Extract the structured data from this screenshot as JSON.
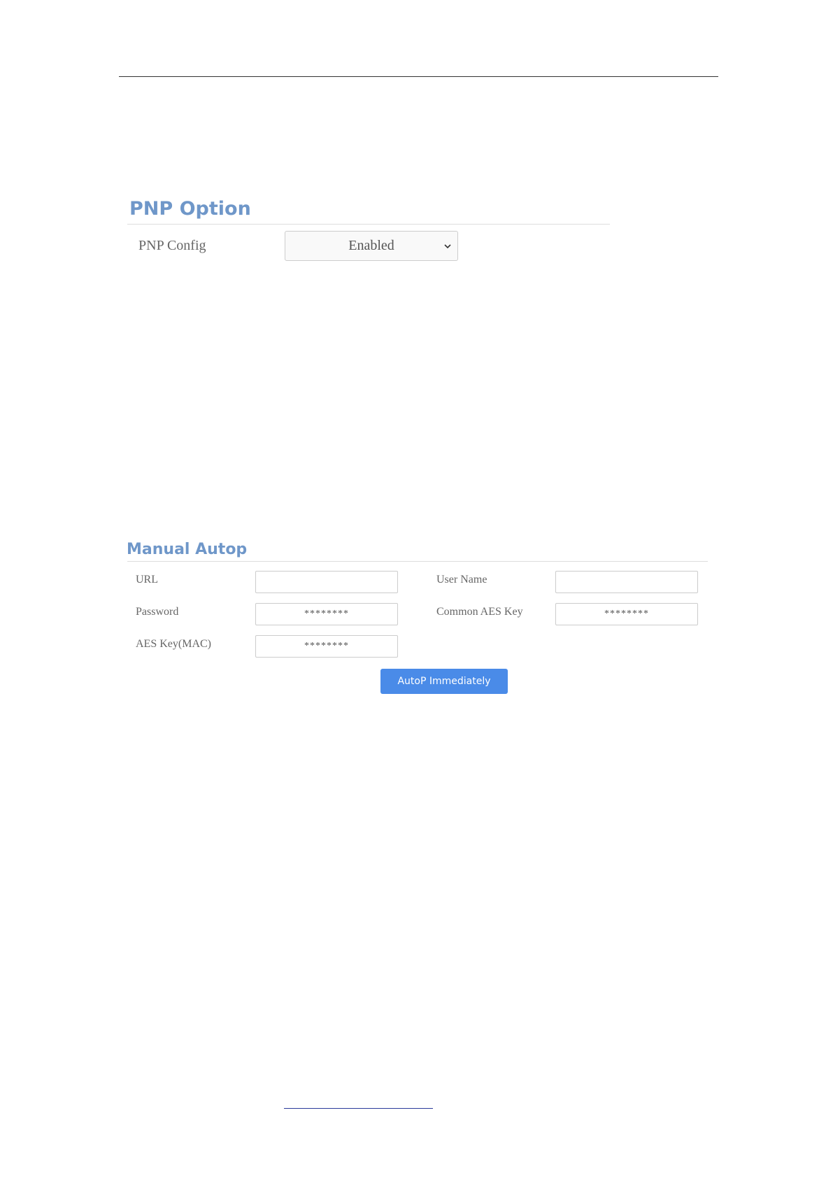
{
  "pnp_option": {
    "title": "PNP Option",
    "pnp_config_label": "PNP Config",
    "pnp_config_value": "Enabled"
  },
  "manual_autop": {
    "title": "Manual Autop",
    "url_label": "URL",
    "url_value": "",
    "user_name_label": "User Name",
    "user_name_value": "",
    "password_label": "Password",
    "password_value": "********",
    "common_aes_key_label": "Common AES Key",
    "common_aes_key_value": "********",
    "aes_key_mac_label": "AES Key(MAC)",
    "aes_key_mac_value": "********",
    "autop_button_label": "AutoP Immediately"
  },
  "colors": {
    "section_title": "#6f97c9",
    "button_bg": "#4a8be8",
    "button_text": "#ffffff",
    "label_text": "#666666"
  },
  "icons": {
    "select_chevron": "chevron-down-icon"
  }
}
